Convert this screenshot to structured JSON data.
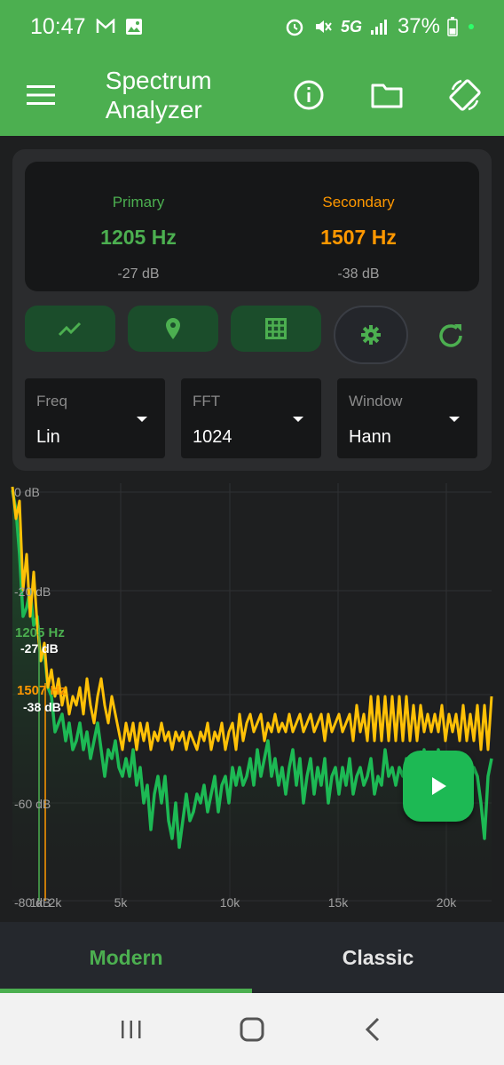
{
  "status_bar": {
    "time": "10:47",
    "network": "5G",
    "battery": "37%"
  },
  "app_bar": {
    "title": "Spectrum Analyzer"
  },
  "peaks": {
    "primary": {
      "label": "Primary",
      "freq": "1205 Hz",
      "level": "-27 dB"
    },
    "secondary": {
      "label": "Secondary",
      "freq": "1507 Hz",
      "level": "-38 dB"
    }
  },
  "tools": {
    "buttons": [
      "trend-icon",
      "marker-pin-icon",
      "grid-icon",
      "gear-icon",
      "refresh-icon"
    ]
  },
  "dropdowns": [
    {
      "caption": "Freq",
      "value": "Lin"
    },
    {
      "caption": "FFT",
      "value": "1024"
    },
    {
      "caption": "Window",
      "value": "Hann"
    }
  ],
  "plot": {
    "y_labels": [
      "0 dB",
      "-20 dB",
      "-60 dB",
      "-80 dB"
    ],
    "x_labels": [
      "1k",
      "2k",
      "5k",
      "10k",
      "15k",
      "20k"
    ],
    "markers": [
      {
        "freq": "1205 Hz",
        "level": "-27 dB",
        "color": "#4caf50"
      },
      {
        "freq": "1507 Hz",
        "level": "-38 dB",
        "color": "#ff9800"
      }
    ]
  },
  "tabs": {
    "modern": "Modern",
    "classic": "Classic"
  },
  "colors": {
    "accent": "#4caf50",
    "secondary": "#ff9800",
    "play": "#1db954"
  }
}
